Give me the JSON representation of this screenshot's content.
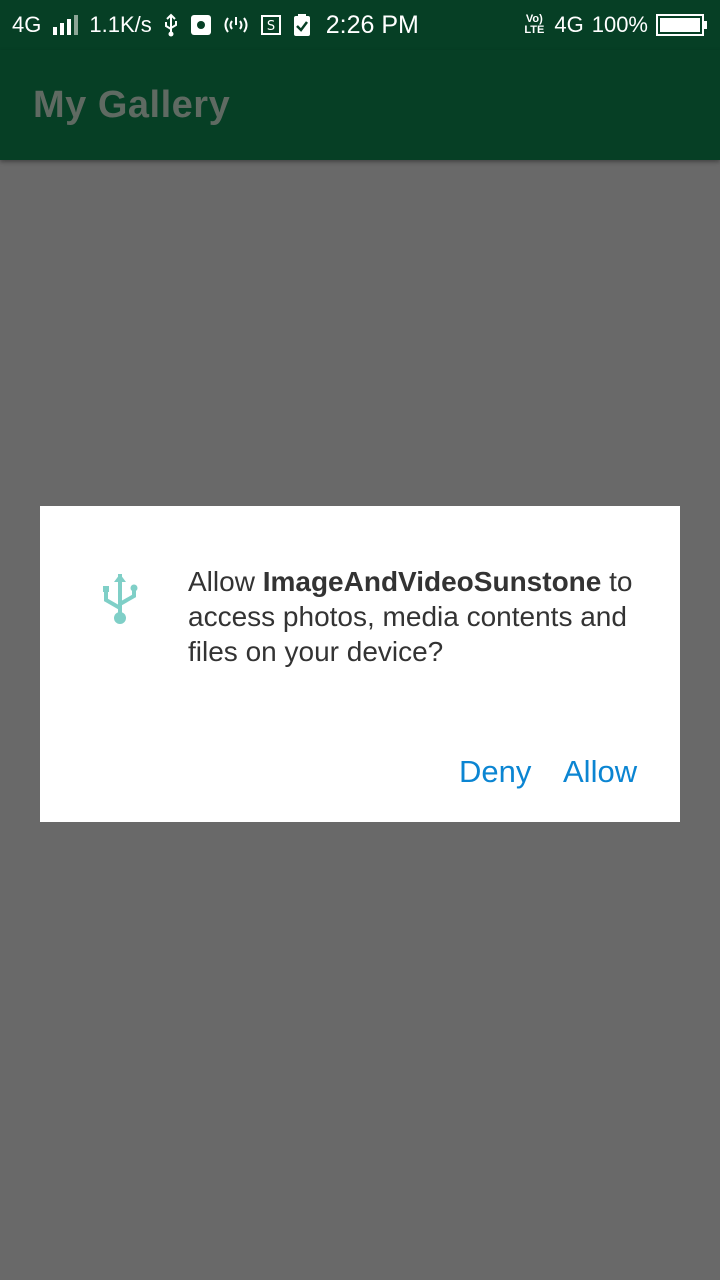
{
  "status_bar": {
    "network_label": "4G",
    "speed": "1.1K/s",
    "time": "2:26 PM",
    "volte_label": "Vo) LTE",
    "network_right": "4G",
    "battery_percent": "100%"
  },
  "app_bar": {
    "title": "My Gallery"
  },
  "dialog": {
    "icon": "usb-icon",
    "message_prefix": "Allow ",
    "app_name": "ImageAndVideoSunstone",
    "message_suffix": " to access photos, media contents and files on your device?",
    "deny_label": "Deny",
    "allow_label": "Allow"
  },
  "colors": {
    "status_bar": "#063f25",
    "app_bar": "#063f25",
    "scrim": "#696969",
    "dialog_bg": "#ffffff",
    "accent": "#0b85d2",
    "icon": "#7fcfc7"
  }
}
